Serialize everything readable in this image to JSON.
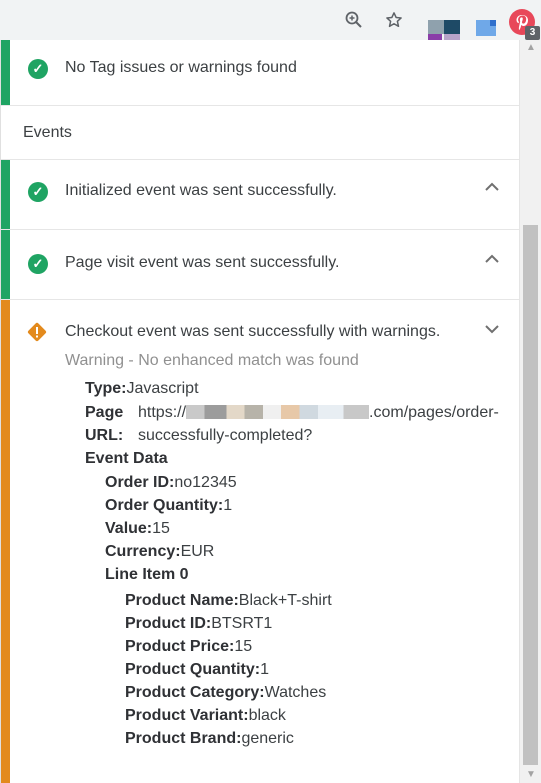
{
  "toolbar": {
    "icons": [
      "zoom-icon",
      "star-icon",
      "extension-icon",
      "extension-icon",
      "pinterest-tag-helper-icon"
    ],
    "badge_count": "3"
  },
  "panel": {
    "tag_status": {
      "text": "No Tag issues or warnings found",
      "status": "success",
      "color": "#1fa463"
    },
    "events_title": "Events",
    "events": [
      {
        "text": "Initialized event was sent successfully.",
        "status": "success",
        "expanded": false
      },
      {
        "text": "Page visit event was sent successfully.",
        "status": "success",
        "expanded": false
      },
      {
        "text": "Checkout event was sent successfully with warnings.",
        "status": "warning",
        "color": "#e38a1d",
        "expanded": true,
        "warning": "Warning - No enhanced match was found",
        "details": {
          "type_label": "Type:",
          "type_value": "Javascript",
          "page_url_label_1": "Page",
          "page_url_label_2": "URL:",
          "page_url_value_1_start": "https://",
          "page_url_value_1_end": ".com/pages/order-",
          "page_url_value_2": "successfully-completed?",
          "event_data_label": "Event Data",
          "order_id_label": "Order ID:",
          "order_id": "no12345",
          "order_quantity_label": "Order Quantity:",
          "order_quantity": "1",
          "value_label": "Value:",
          "value": "15",
          "currency_label": "Currency:",
          "currency": "EUR",
          "line_item_label": "Line Item 0",
          "product_name_label": "Product Name:",
          "product_name": "Black+T-shirt",
          "product_id_label": "Product ID:",
          "product_id": "BTSRT1",
          "product_price_label": "Product Price:",
          "product_price": "15",
          "product_quantity_label": "Product Quantity:",
          "product_quantity": "1",
          "product_category_label": "Product Category:",
          "product_category": "Watches",
          "product_variant_label": "Product Variant:",
          "product_variant": "black",
          "product_brand_label": "Product Brand:",
          "product_brand": "generic"
        }
      }
    ]
  }
}
